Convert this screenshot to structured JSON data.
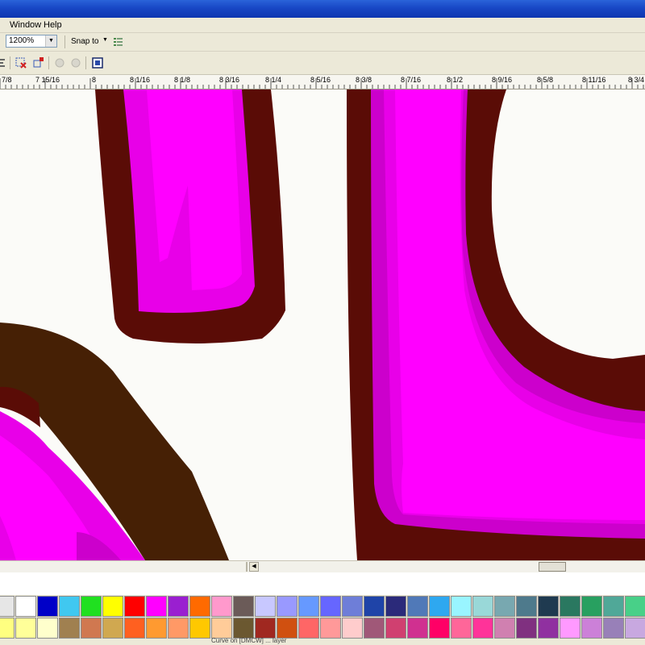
{
  "menu": {
    "window": "Window",
    "help": "Help"
  },
  "toolbar": {
    "zoom_value": "1200%",
    "snap_label": "Snap to"
  },
  "ruler": {
    "labels": [
      "7/8",
      "7 15/16",
      "8",
      "8 1/16",
      "8 1/8",
      "8 3/16",
      "8 1/4",
      "8 5/16",
      "8 3/8",
      "8 7/16",
      "8 1/2",
      "8 9/16",
      "8 5/8",
      "8 11/16",
      "8 3/4"
    ]
  },
  "colors": {
    "magenta": "#ff00ff",
    "magenta_mid": "#e800e8",
    "magenta_dark": "#cc00cc",
    "maroon": "#5a0c06",
    "dark_brown": "#462005",
    "palette_row1": [
      "#e6e6e6",
      "#ffffff",
      "#0000c8",
      "#40c8f0",
      "#20e020",
      "#ffff00",
      "#ff0000",
      "#ff00ff",
      "#9a1fd0",
      "#ff6a00",
      "#ff99cc",
      "#6b5b58",
      "#c8c8ff",
      "#9999ff",
      "#6699ff",
      "#6666ff",
      "#6e7ed8",
      "#1f44a8",
      "#2b2a7a",
      "#5079b8",
      "#2ea8f0",
      "#99f5ff",
      "#99d8d8",
      "#78a8b0",
      "#4e7a8c",
      "#1f3a50",
      "#2a7860",
      "#28a060",
      "#50a898",
      "#48d088",
      "#00ff00"
    ],
    "palette_row2": [
      "#ffff80",
      "#ffff99",
      "#ffffcc",
      "#a08050",
      "#d07850",
      "#d0a850",
      "#ff6020",
      "#ff9a30",
      "#ff9966",
      "#ffc800",
      "#ffcc99",
      "#6b5830",
      "#a02820",
      "#d05010",
      "#ff6666",
      "#ff9999",
      "#ffcccc",
      "#a05878",
      "#d04070",
      "#d03090",
      "#ff0066",
      "#ff6699",
      "#ff3399",
      "#d080b0",
      "#803080",
      "#9030a0",
      "#ff99ff",
      "#cc80d8",
      "#9880b8",
      "#c8a8e0",
      "#9a30c8"
    ]
  },
  "status": {
    "text": "Curve on [DMCW] ... layer"
  }
}
